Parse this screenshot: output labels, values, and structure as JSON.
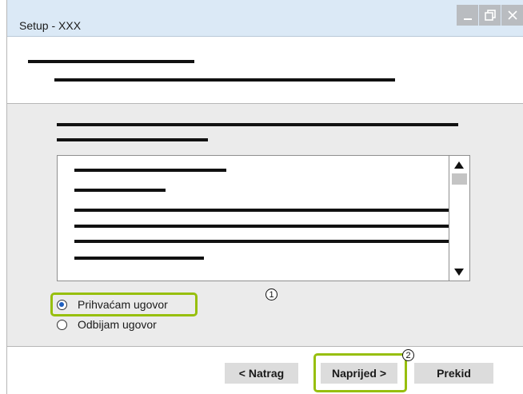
{
  "window": {
    "title": "Setup - XXX"
  },
  "license_agreement": {
    "accept_label": "Prihvaćam ugovor",
    "decline_label": "Odbijam ugovor",
    "selected": "accept"
  },
  "buttons": {
    "back_label": "< Natrag",
    "next_label": "Naprijed >",
    "cancel_label": "Prekid"
  },
  "callouts": {
    "one": "1",
    "two": "2"
  },
  "colors": {
    "highlight": "#97bf0d",
    "titlebar": "#dbe9f6",
    "content_bg": "#ebebeb",
    "button_bg": "#dcdcdc"
  },
  "icons": {
    "minimize": "minimize-icon",
    "restore": "restore-icon",
    "close": "close-icon",
    "scroll_up": "scroll-up-arrow-icon",
    "scroll_down": "scroll-down-arrow-icon"
  }
}
